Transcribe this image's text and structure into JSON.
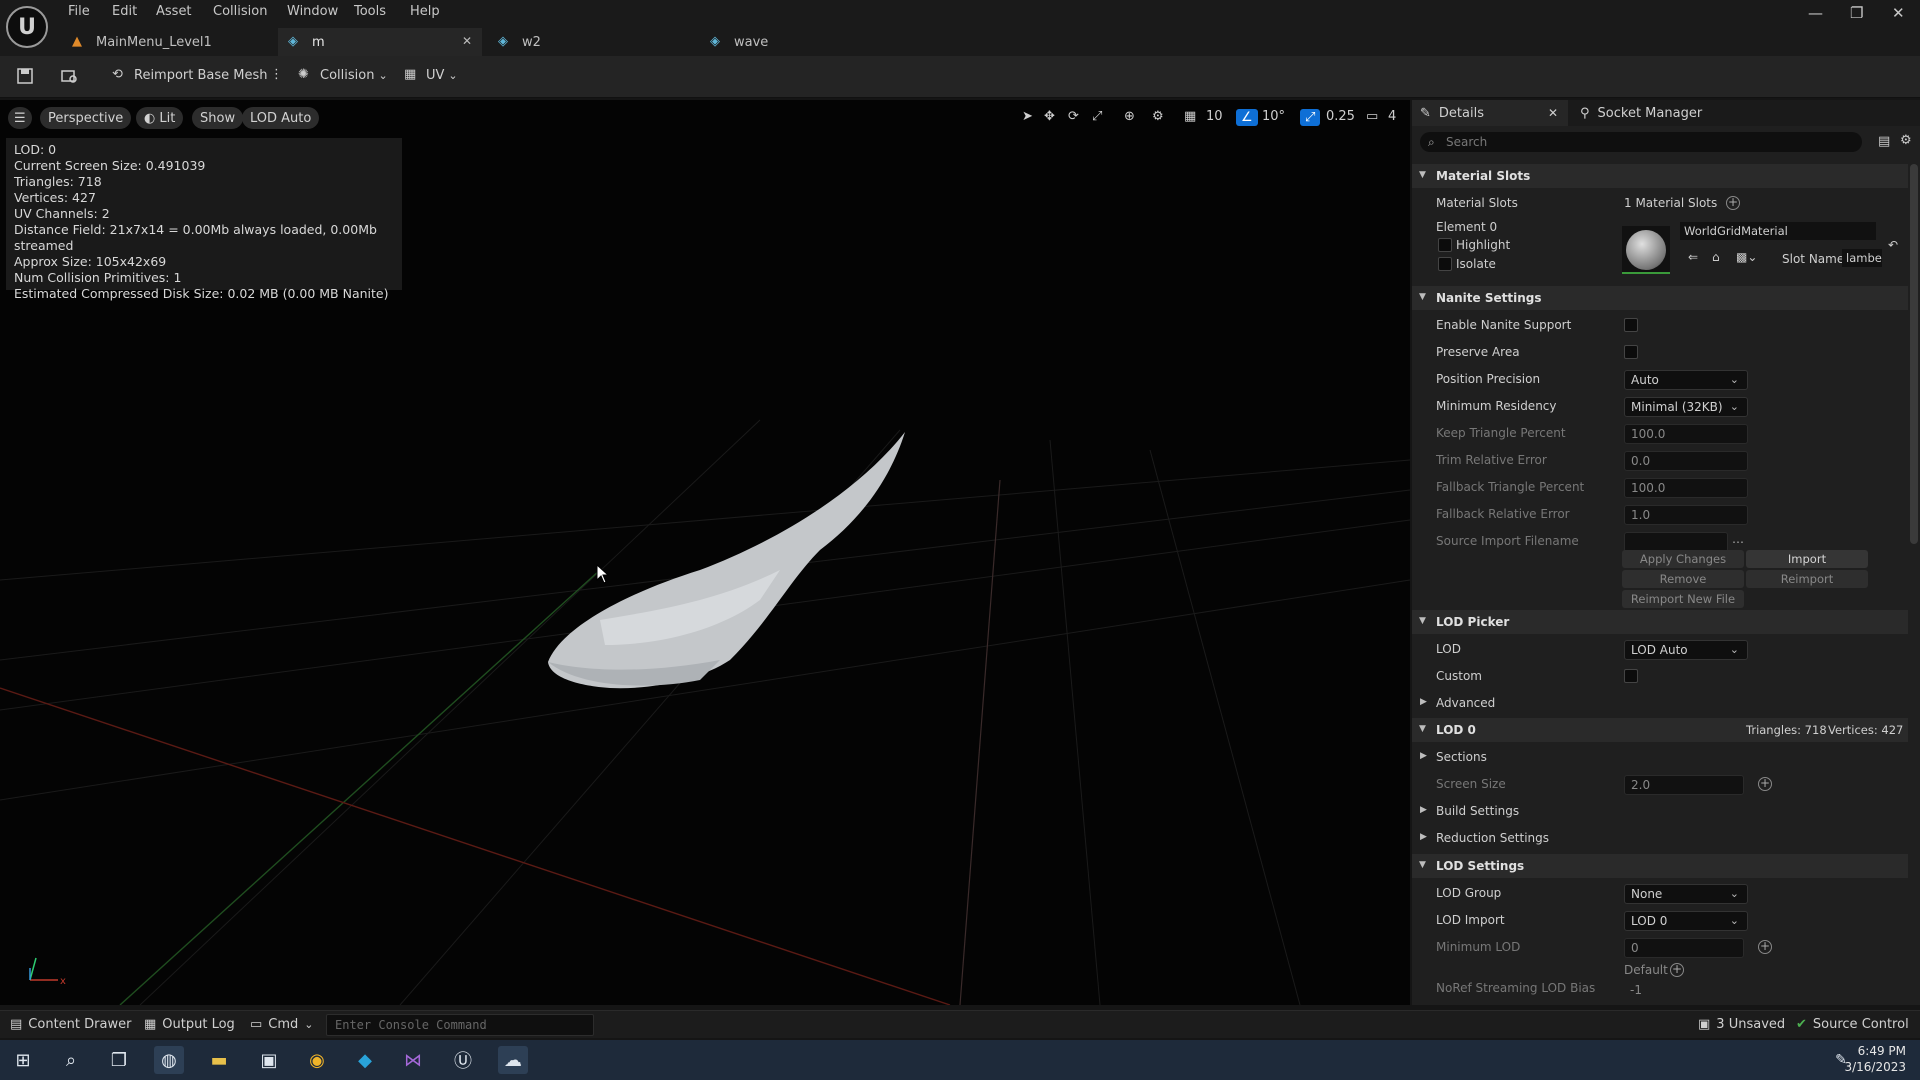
{
  "menu": [
    "File",
    "Edit",
    "Asset",
    "Collision",
    "Window",
    "Tools",
    "Help"
  ],
  "tabs": [
    {
      "label": "MainMenu_Level1"
    },
    {
      "label": "m"
    },
    {
      "label": "w2"
    },
    {
      "label": "wave"
    }
  ],
  "toolbar": {
    "reimport_label": "Reimport Base Mesh",
    "collision_label": "Collision",
    "uv_label": "UV"
  },
  "viewport": {
    "perspective_label": "Perspective",
    "lit_label": "Lit",
    "show_label": "Show",
    "lod_label": "LOD Auto",
    "grid_value": "10",
    "angle_value": "10°",
    "scale_value": "0.25",
    "camera_value": "4",
    "stats": [
      "LOD:  0",
      "Current Screen Size:  0.491039",
      "Triangles:  718",
      "Vertices:  427",
      "UV Channels:  2",
      "Distance Field:  21x7x14 = 0.00Mb always loaded, 0.00Mb streamed",
      "Approx Size: 105x42x69",
      "Num Collision Primitives:  1",
      "Estimated Compressed Disk Size: 0.02 MB (0.00 MB Nanite)"
    ]
  },
  "details": {
    "tab_details": "Details",
    "tab_socket": "Socket Manager",
    "search_placeholder": "Search",
    "material_slots": {
      "category": "Material Slots",
      "label": "Material Slots",
      "value": "1 Material Slots",
      "element": "Element 0",
      "highlight": "Highlight",
      "isolate": "Isolate",
      "material_name": "WorldGridMaterial",
      "slot_name_label": "Slot Name",
      "slot_name_value": "lambe"
    },
    "nanite": {
      "category": "Nanite Settings",
      "enable_label": "Enable Nanite Support",
      "preserve_label": "Preserve Area",
      "position_precision_label": "Position Precision",
      "position_precision_value": "Auto",
      "min_residency_label": "Minimum Residency",
      "min_residency_value": "Minimal (32KB)",
      "keep_triangle_label": "Keep Triangle Percent",
      "keep_triangle_value": "100.0",
      "trim_error_label": "Trim Relative Error",
      "trim_error_value": "0.0",
      "fallback_triangle_label": "Fallback Triangle Percent",
      "fallback_triangle_value": "100.0",
      "fallback_error_label": "Fallback Relative Error",
      "fallback_error_value": "1.0",
      "source_import_label": "Source Import Filename",
      "apply_changes": "Apply Changes",
      "import": "Import",
      "remove": "Remove",
      "reimport": "Reimport",
      "reimport_new_file": "Reimport New File"
    },
    "lod_picker": {
      "category": "LOD Picker",
      "lod_label": "LOD",
      "lod_value": "LOD Auto",
      "custom_label": "Custom",
      "advanced_label": "Advanced"
    },
    "lod0": {
      "category": "LOD 0",
      "triangles": "Triangles: 718",
      "vertices": "Vertices: 427",
      "sections_label": "Sections",
      "screen_size_label": "Screen Size",
      "screen_size_value": "2.0",
      "build_settings_label": "Build Settings",
      "reduction_settings_label": "Reduction Settings"
    },
    "lod_settings": {
      "category": "LOD Settings",
      "lod_group_label": "LOD Group",
      "lod_group_value": "None",
      "lod_import_label": "LOD Import",
      "lod_import_value": "LOD 0",
      "min_lod_label": "Minimum LOD",
      "min_lod_value": "0",
      "default_label": "Default",
      "noref_label": "NoRef Streaming LOD Bias",
      "noref_value": "-1"
    }
  },
  "bottombar": {
    "content_drawer": "Content Drawer",
    "output_log": "Output Log",
    "cmd": "Cmd",
    "console_placeholder": "Enter Console Command",
    "unsaved": "3 Unsaved",
    "source_control": "Source Control"
  },
  "taskbar": {
    "time": "6:49 PM",
    "date": "3/16/2023"
  },
  "colors": {
    "accent_blue": "#0e6fd6",
    "viewport_bg": "#040404",
    "panel_bg": "#1f1f1f"
  }
}
